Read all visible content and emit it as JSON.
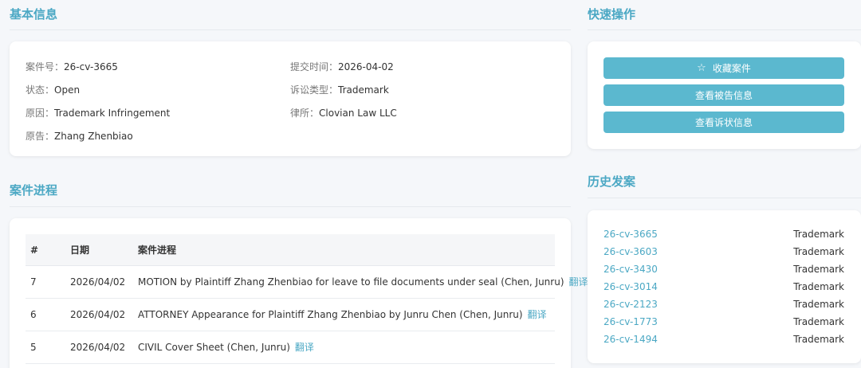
{
  "basic_info": {
    "title": "基本信息",
    "case_no_label": "案件号：",
    "case_no": "26-cv-3665",
    "submitted_label": "提交时间：",
    "submitted": "2026-04-02",
    "status_label": "状态：",
    "status": "Open",
    "suit_type_label": "诉讼类型：",
    "suit_type": "Trademark",
    "cause_label": "原因：",
    "cause": "Trademark Infringement",
    "firm_label": "律所：",
    "firm": "Clovian Law LLC",
    "plaintiff_label": "原告：",
    "plaintiff": "Zhang Zhenbiao"
  },
  "progress": {
    "title": "案件进程",
    "headers": {
      "num": "#",
      "date": "日期",
      "text": "案件进程"
    },
    "translate_label": "翻译",
    "rows": [
      {
        "num": "7",
        "date": "2026/04/02",
        "text": "MOTION by Plaintiff Zhang Zhenbiao for leave to file documents under seal (Chen, Junru)"
      },
      {
        "num": "6",
        "date": "2026/04/02",
        "text": "ATTORNEY Appearance for Plaintiff Zhang Zhenbiao by Junru Chen (Chen, Junru)"
      },
      {
        "num": "5",
        "date": "2026/04/02",
        "text": "CIVIL Cover Sheet (Chen, Junru)"
      }
    ]
  },
  "quick_actions": {
    "title": "快速操作",
    "favorite": "收藏案件",
    "view_defendants": "查看被告信息",
    "view_complaint": "查看诉状信息"
  },
  "history": {
    "title": "历史发案",
    "items": [
      {
        "case": "26-cv-3665",
        "type": "Trademark"
      },
      {
        "case": "26-cv-3603",
        "type": "Trademark"
      },
      {
        "case": "26-cv-3430",
        "type": "Trademark"
      },
      {
        "case": "26-cv-3014",
        "type": "Trademark"
      },
      {
        "case": "26-cv-2123",
        "type": "Trademark"
      },
      {
        "case": "26-cv-1773",
        "type": "Trademark"
      },
      {
        "case": "26-cv-1494",
        "type": "Trademark"
      }
    ]
  }
}
